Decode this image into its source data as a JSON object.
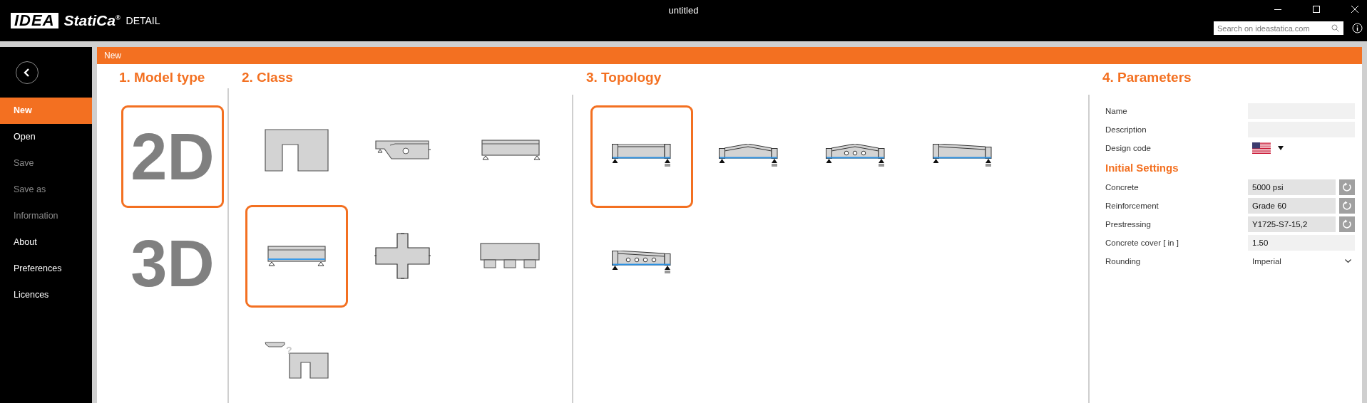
{
  "app": {
    "logo": "IDEA",
    "name": "StatiCa$^{®}$",
    "product": "DETAIL"
  },
  "window": {
    "title": "untitled"
  },
  "search": {
    "placeholder": "Search on ideastatica.com"
  },
  "sidebar": {
    "items": [
      {
        "label": "New",
        "selected": true,
        "disabled": false
      },
      {
        "label": "Open",
        "selected": false,
        "disabled": false
      },
      {
        "label": "Save",
        "selected": false,
        "disabled": true
      },
      {
        "label": "Save as",
        "selected": false,
        "disabled": true
      },
      {
        "label": "Information",
        "selected": false,
        "disabled": true
      },
      {
        "label": "About",
        "selected": false,
        "disabled": false
      },
      {
        "label": "Preferences",
        "selected": false,
        "disabled": false
      },
      {
        "label": "Licences",
        "selected": false,
        "disabled": false
      }
    ]
  },
  "panel": {
    "title": "New"
  },
  "model_type": {
    "heading": "1. Model type",
    "options": [
      {
        "label": "2D",
        "selected": true
      },
      {
        "label": "3D",
        "selected": false
      }
    ]
  },
  "class": {
    "heading": "2. Class",
    "options": [
      {
        "kind": "opening",
        "selected": false
      },
      {
        "kind": "dapped",
        "selected": false
      },
      {
        "kind": "beam",
        "selected": false
      },
      {
        "kind": "prestressed",
        "selected": true
      },
      {
        "kind": "joint",
        "selected": false
      },
      {
        "kind": "pilecap",
        "selected": false
      },
      {
        "kind": "custom",
        "selected": false,
        "mark": "?"
      }
    ]
  },
  "topology": {
    "heading": "3. Topology",
    "options": [
      {
        "kind": "straight",
        "selected": true
      },
      {
        "kind": "gable",
        "selected": false
      },
      {
        "kind": "gableholes",
        "selected": false
      },
      {
        "kind": "tapered",
        "selected": false
      },
      {
        "kind": "taperedholes",
        "selected": false
      }
    ]
  },
  "parameters": {
    "heading": "4. Parameters",
    "fields": [
      {
        "label": "Name",
        "kind": "text"
      },
      {
        "label": "Description",
        "kind": "text"
      },
      {
        "label": "Design code",
        "kind": "flag"
      }
    ],
    "settings_heading": "Initial Settings",
    "settings": [
      {
        "label": "Concrete",
        "kind": "material",
        "value": "5000 psi"
      },
      {
        "label": "Reinforcement",
        "kind": "material",
        "value": "Grade 60"
      },
      {
        "label": "Prestressing",
        "kind": "material",
        "value": "Y1725-S7-15,2"
      },
      {
        "label": "Concrete cover  [ in ]",
        "kind": "text",
        "value": "1.50"
      },
      {
        "label": "Rounding",
        "kind": "select",
        "value": "Imperial"
      }
    ]
  }
}
